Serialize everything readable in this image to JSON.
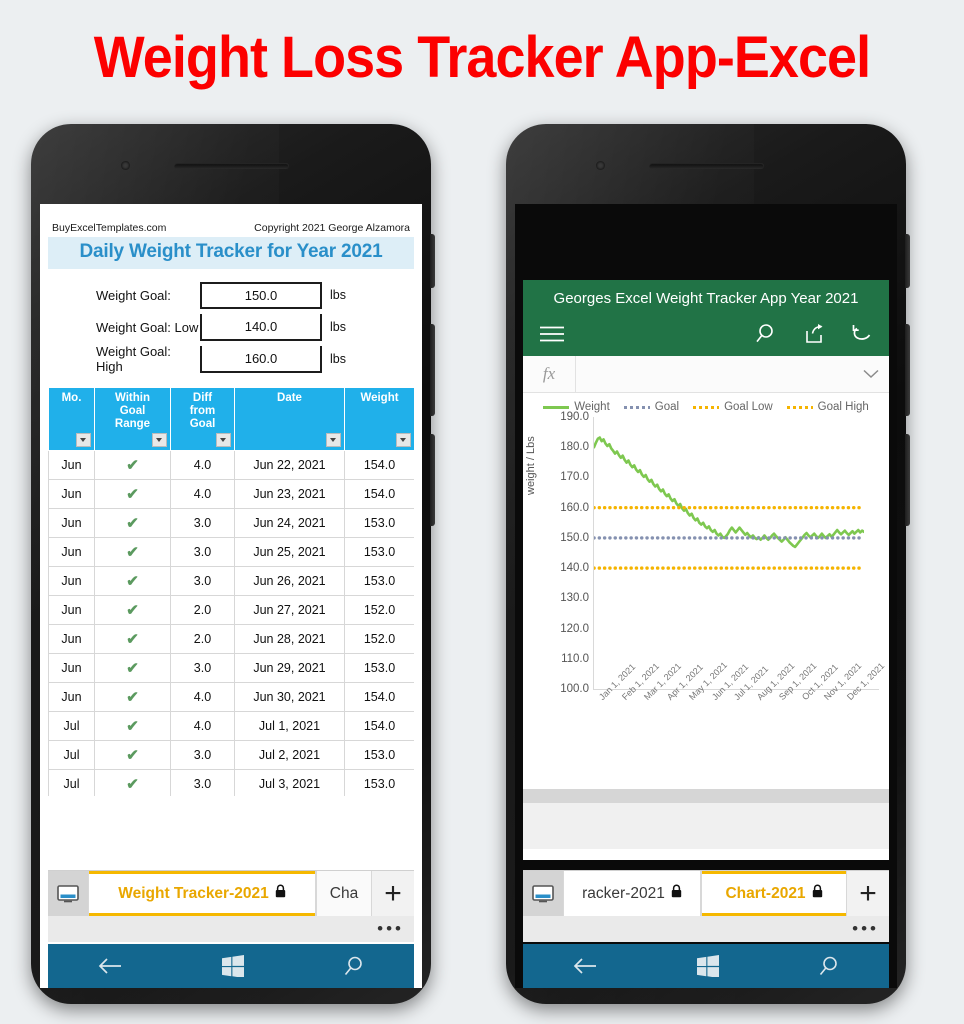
{
  "page": {
    "title": "Weight Loss Tracker App-Excel",
    "title_color": "#fc0000",
    "background": "#eceff1"
  },
  "left_phone": {
    "sheet": {
      "header_left": "BuyExcelTemplates.com",
      "header_right": "Copyright 2021  George Alzamora",
      "title": "Daily Weight Tracker for Year 2021",
      "title_bg": "#ddeef7",
      "title_color": "#2a8fc9",
      "goals": [
        {
          "label": "Weight Goal:",
          "value": "150.0",
          "unit": "lbs"
        },
        {
          "label": "Weight Goal: Low",
          "value": "140.0",
          "unit": "lbs"
        },
        {
          "label": "Weight Goal: High",
          "value": "160.0",
          "unit": "lbs"
        }
      ],
      "table": {
        "header_bg": "#20b0ea",
        "columns": [
          "Mo.",
          "Within Goal Range",
          "Diff from Goal",
          "Date",
          "Weight"
        ],
        "columns_multiline": [
          [
            "Mo."
          ],
          [
            "Within",
            "Goal",
            "Range"
          ],
          [
            "Diff",
            "from",
            "Goal"
          ],
          [
            "Date"
          ],
          [
            "Weight"
          ]
        ],
        "check_glyph": "✔",
        "rows": [
          {
            "mo": "Jun",
            "within": true,
            "diff": "4.0",
            "date": "Jun 22, 2021",
            "weight": "154.0"
          },
          {
            "mo": "Jun",
            "within": true,
            "diff": "4.0",
            "date": "Jun 23, 2021",
            "weight": "154.0"
          },
          {
            "mo": "Jun",
            "within": true,
            "diff": "3.0",
            "date": "Jun 24, 2021",
            "weight": "153.0"
          },
          {
            "mo": "Jun",
            "within": true,
            "diff": "3.0",
            "date": "Jun 25, 2021",
            "weight": "153.0"
          },
          {
            "mo": "Jun",
            "within": true,
            "diff": "3.0",
            "date": "Jun 26, 2021",
            "weight": "153.0"
          },
          {
            "mo": "Jun",
            "within": true,
            "diff": "2.0",
            "date": "Jun 27, 2021",
            "weight": "152.0"
          },
          {
            "mo": "Jun",
            "within": true,
            "diff": "2.0",
            "date": "Jun 28, 2021",
            "weight": "152.0"
          },
          {
            "mo": "Jun",
            "within": true,
            "diff": "3.0",
            "date": "Jun 29, 2021",
            "weight": "153.0"
          },
          {
            "mo": "Jun",
            "within": true,
            "diff": "4.0",
            "date": "Jun 30, 2021",
            "weight": "154.0"
          },
          {
            "mo": "Jul",
            "within": true,
            "diff": "4.0",
            "date": "Jul 1, 2021",
            "weight": "154.0"
          },
          {
            "mo": "Jul",
            "within": true,
            "diff": "3.0",
            "date": "Jul 2, 2021",
            "weight": "153.0"
          },
          {
            "mo": "Jul",
            "within": true,
            "diff": "3.0",
            "date": "Jul 3, 2021",
            "weight": "153.0"
          }
        ]
      }
    },
    "tabs": {
      "active": "Weight Tracker-2021",
      "inactive": "Cha",
      "lock_glyph": "🔒",
      "add_label": "+",
      "overflow_label": "•••"
    },
    "navbar": {
      "back": "back-arrow",
      "home": "windows-logo",
      "search": "search"
    }
  },
  "right_phone": {
    "excel": {
      "app_title": "Georges Excel Weight Tracker App Year 2021",
      "header_bg": "#217346",
      "ribbon_icons": [
        "hamburger-menu",
        "search",
        "share",
        "undo"
      ],
      "formula_prefix": "fx",
      "formula_value": ""
    },
    "tabs": {
      "inactive": "racker-2021",
      "active": "Chart-2021",
      "lock_glyph": "🔒",
      "add_label": "+",
      "overflow_label": "•••"
    },
    "navbar": {
      "back": "back-arrow",
      "home": "windows-logo",
      "search": "search"
    }
  },
  "chart_data": {
    "type": "line",
    "title": "",
    "xlabel": "",
    "ylabel": "weight / Lbs",
    "ylim": [
      100.0,
      190.0
    ],
    "yticks": [
      100.0,
      110.0,
      120.0,
      130.0,
      140.0,
      150.0,
      160.0,
      170.0,
      180.0,
      190.0
    ],
    "ytick_labels": [
      "100.0",
      "110.0",
      "120.0",
      "130.0",
      "140.0",
      "150.0",
      "160.0",
      "170.0",
      "180.0",
      "190.0"
    ],
    "xticks": [
      "Jan 1, 2021",
      "Feb 1, 2021",
      "Mar 1, 2021",
      "Apr 1, 2021",
      "May 1, 2021",
      "Jun 1, 2021",
      "Jul 1, 2021",
      "Aug 1, 2021",
      "Sep 1, 2021",
      "Oct 1, 2021",
      "Nov 1, 2021",
      "Dec 1, 2021"
    ],
    "legend_position": "top",
    "grid": false,
    "series": [
      {
        "name": "Weight",
        "color": "#7ec850",
        "style": "solid",
        "values": [
          180.0,
          181.5,
          182.8,
          183.2,
          182.0,
          182.6,
          181.2,
          180.4,
          181.0,
          179.6,
          178.8,
          177.9,
          178.6,
          177.4,
          176.5,
          177.2,
          175.8,
          174.9,
          175.6,
          174.2,
          173.4,
          174.0,
          172.6,
          171.8,
          172.4,
          171.0,
          170.2,
          170.8,
          169.4,
          168.6,
          169.2,
          167.8,
          167.0,
          167.6,
          166.2,
          165.4,
          166.0,
          164.6,
          163.8,
          164.4,
          163.0,
          162.2,
          162.8,
          161.4,
          160.6,
          161.2,
          159.8,
          159.0,
          159.6,
          158.2,
          157.4,
          158.0,
          156.6,
          155.8,
          156.4,
          155.0,
          154.4,
          155.0,
          153.8,
          153.2,
          153.8,
          152.6,
          152.0,
          152.6,
          151.4,
          150.8,
          151.4,
          150.4,
          150.0,
          150.6,
          151.4,
          152.6,
          153.4,
          152.6,
          151.8,
          152.6,
          153.4,
          152.6,
          151.8,
          151.0,
          151.6,
          150.8,
          150.2,
          150.8,
          150.0,
          149.6,
          150.2,
          149.4,
          150.0,
          150.8,
          150.0,
          149.4,
          150.0,
          150.8,
          151.4,
          150.6,
          150.0,
          149.4,
          148.8,
          149.4,
          150.2,
          149.4,
          148.6,
          148.0,
          147.4,
          147.0,
          147.8,
          148.6,
          149.4,
          150.2,
          151.0,
          151.6,
          150.8,
          150.2,
          150.8,
          151.4,
          150.6,
          150.0,
          150.6,
          151.4,
          150.6,
          150.0,
          150.6,
          151.2,
          150.4,
          151.0,
          151.8,
          152.6,
          151.8,
          151.2,
          151.8,
          152.4,
          151.6,
          151.0,
          151.6,
          152.2,
          151.4,
          152.0,
          152.6,
          151.8,
          152.4,
          152.0
        ]
      },
      {
        "name": "Goal",
        "color": "#8591b0",
        "style": "dotted",
        "value": 150.0
      },
      {
        "name": "Goal Low",
        "color": "#f5b400",
        "style": "dotted",
        "value": 140.0
      },
      {
        "name": "Goal High",
        "color": "#f5b400",
        "style": "dotted",
        "value": 160.0
      }
    ]
  }
}
